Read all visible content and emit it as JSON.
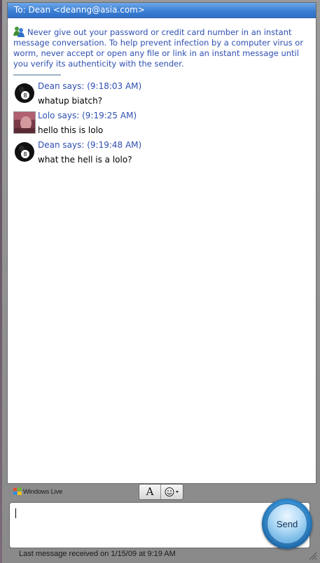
{
  "header": {
    "to_label": "To: Dean <deanng@asia.com>"
  },
  "warning": {
    "text": "Never give out your password or credit card number in an instant message conversation. To help prevent infection by a computer virus or worm, never accept or open any file or link in an instant message until you verify its authenticity with the sender.",
    "icon": "msn-buddy-icon"
  },
  "messages": [
    {
      "sender_line": "Dean says: (9:18:03 AM)",
      "text": "whatup biatch?",
      "avatar": "eight-ball-avatar"
    },
    {
      "sender_line": "Lolo says: (9:19:25 AM)",
      "text": "hello this is lolo",
      "avatar": "photo-avatar"
    },
    {
      "sender_line": "Dean says: (9:19:48 AM)",
      "text": "what the hell is a lolo?",
      "avatar": "eight-ball-avatar"
    }
  ],
  "toolbar": {
    "brand": "Windows Live",
    "font_button_label": "A",
    "emoticon_icon": "smiley-icon"
  },
  "compose": {
    "value": "",
    "send_label": "Send"
  },
  "status": {
    "last_message": "Last message received on 1/15/09 at 9:19 AM"
  },
  "colors": {
    "title_bar": "#3b7fd4",
    "link_blue": "#2e4fb2",
    "send_button": "#7fbde9"
  }
}
